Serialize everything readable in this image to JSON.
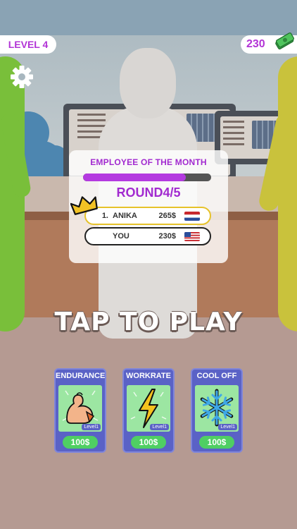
{
  "hud": {
    "level_label": "LEVEL 4",
    "cash_amount": "230",
    "money_icon": "money-stack-icon",
    "settings_icon": "gear-icon"
  },
  "leaderboard": {
    "title": "EMPLOYEE OF THE MONTH",
    "progress_fraction": 0.8,
    "round_label": "ROUND4/5",
    "rows": [
      {
        "rank": "1.",
        "name": "ANIKA",
        "score": "265$",
        "flag": "netherlands-flag"
      },
      {
        "rank": "",
        "name": "YOU",
        "score": "230$",
        "flag": "usa-flag"
      }
    ]
  },
  "cta": {
    "text": "TAP TO PLAY"
  },
  "upgrades": [
    {
      "title": "ENDURANCE",
      "level": "Level1",
      "price": "100$",
      "icon": "flexed-bicep-icon"
    },
    {
      "title": "WORKRATE",
      "level": "Level1",
      "price": "100$",
      "icon": "lightning-bolt-icon"
    },
    {
      "title": "COOL OFF",
      "level": "Level1",
      "price": "100$",
      "icon": "snowflake-icon"
    }
  ],
  "colors": {
    "accent_purple": "#b234d6",
    "card_blue": "#5a62c6",
    "price_green": "#4fcf63",
    "leader_border": "#e6c22a"
  }
}
